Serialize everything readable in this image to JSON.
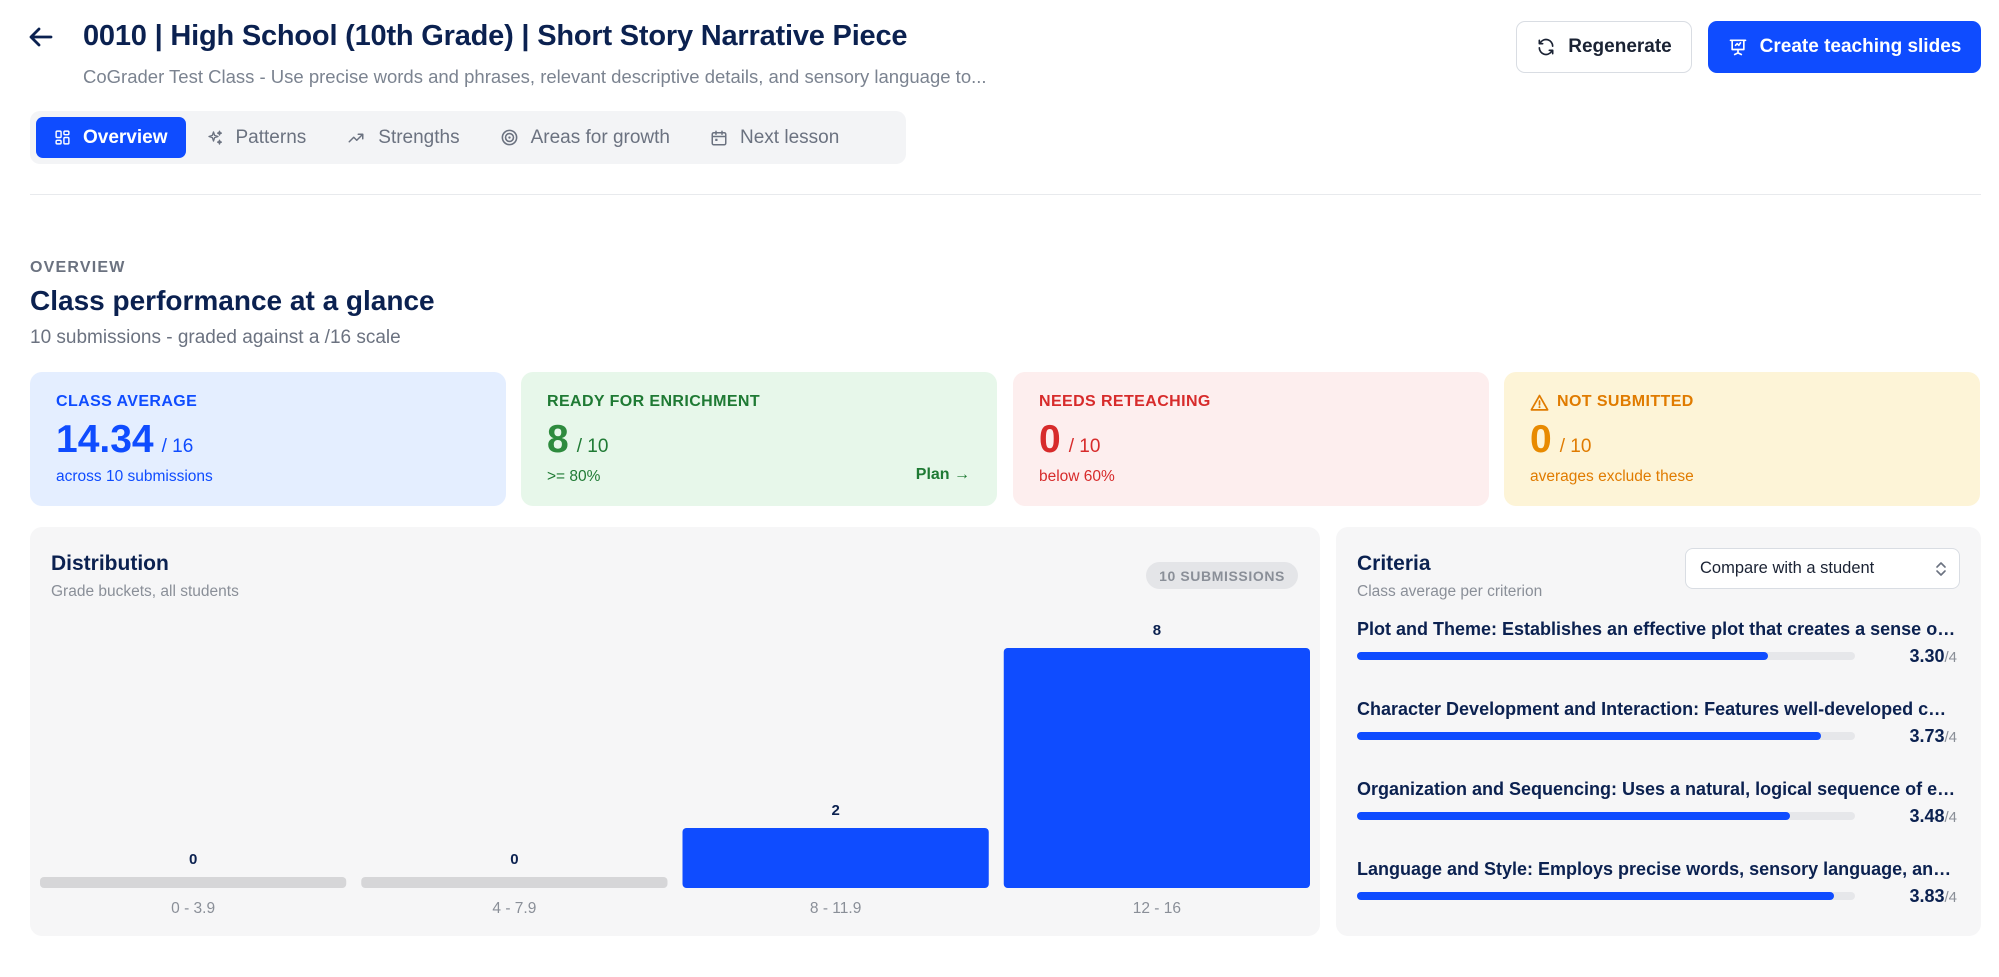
{
  "header": {
    "title": "0010 | High School (10th Grade) | Short Story Narrative Piece",
    "subtitle": "CoGrader Test Class - Use precise words and phrases, relevant descriptive details, and sensory language to...",
    "regenerate_label": "Regenerate",
    "slides_label": "Create teaching slides"
  },
  "tabs": [
    {
      "label": "Overview",
      "icon": "grid-icon",
      "active": true
    },
    {
      "label": "Patterns",
      "icon": "sparkles-icon",
      "active": false
    },
    {
      "label": "Strengths",
      "icon": "trending-up-icon",
      "active": false
    },
    {
      "label": "Areas for growth",
      "icon": "target-icon",
      "active": false
    },
    {
      "label": "Next lesson",
      "icon": "calendar-icon",
      "active": false
    }
  ],
  "overview": {
    "eyebrow": "OVERVIEW",
    "title": "Class performance at a glance",
    "subtitle": "10 submissions - graded against a /16 scale"
  },
  "stats": {
    "average": {
      "label": "CLASS AVERAGE",
      "value": "14.34",
      "of": "/ 16",
      "note": "across 10 submissions"
    },
    "enrichment": {
      "label": "READY FOR ENRICHMENT",
      "value": "8",
      "of": "/ 10",
      "note": ">= 80%",
      "action": "Plan →"
    },
    "reteaching": {
      "label": "NEEDS RETEACHING",
      "value": "0",
      "of": "/ 10",
      "note": "below 60%"
    },
    "not_submitted": {
      "label": "NOT SUBMITTED",
      "value": "0",
      "of": "/ 10",
      "note": "averages exclude these",
      "icon": "warning-icon"
    }
  },
  "distribution": {
    "title": "Distribution",
    "subtitle": "Grade buckets, all students",
    "badge": "10 SUBMISSIONS"
  },
  "chart_data": {
    "type": "bar",
    "categories": [
      "0 - 3.9",
      "4 - 7.9",
      "8 - 11.9",
      "12 - 16"
    ],
    "values": [
      0,
      0,
      2,
      8
    ],
    "ylim": [
      0,
      8
    ],
    "bar_color": "#0f4cff",
    "empty_color": "#d6d6d8"
  },
  "criteria": {
    "title": "Criteria",
    "subtitle": "Class average per criterion",
    "compare_label": "Compare with a student",
    "max_label": "/4",
    "max": 4,
    "items": [
      {
        "name": "Plot and Theme: Establishes an effective plot that creates a sense of conflict and resolution",
        "score": "3.30",
        "value": 3.3
      },
      {
        "name": "Character Development and Interaction: Features well-developed characters",
        "score": "3.73",
        "value": 3.73
      },
      {
        "name": "Organization and Sequencing: Uses a natural, logical sequence of events",
        "score": "3.48",
        "value": 3.48
      },
      {
        "name": "Language and Style: Employs precise words, sensory language, and descriptive details",
        "score": "3.83",
        "value": 3.83
      }
    ]
  },
  "colors": {
    "accent": "#0f4cff",
    "title": "#0b2150",
    "enrichment": "#2e8b3e",
    "reteaching": "#d72b2b",
    "not_submitted": "#e88a00"
  }
}
